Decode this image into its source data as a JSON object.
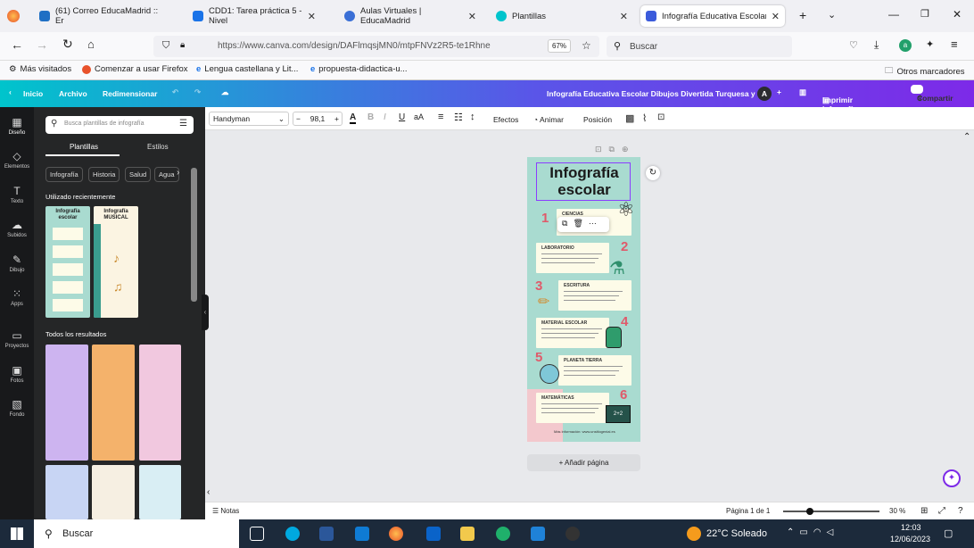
{
  "tabs": [
    {
      "label": "(61) Correo EducaMadrid :: Er"
    },
    {
      "label": "CDD1: Tarea práctica 5 - Nivel"
    },
    {
      "label": "Aulas Virtuales | EducaMadrid"
    },
    {
      "label": "Plantillas"
    },
    {
      "label": "Infografía Educativa Escolar D"
    }
  ],
  "nav": {
    "url": "https://www.canva.com/design/DAFlmqsjMN0/mtpFNVz2R5-te1Rhne",
    "zoom": "67%",
    "search_placeholder": "Buscar"
  },
  "bookmarks": {
    "items": [
      "Más visitados",
      "Comenzar a usar Firefox",
      "Lengua castellana y Lit...",
      "propuesta-didactica-u..."
    ],
    "other": "Otros marcadores"
  },
  "canva": {
    "back": "Inicio",
    "archivo": "Archivo",
    "redimensionar": "Redimensionar",
    "doc_title": "Infografía Educativa Escolar Dibujos Divertida Turquesa y C...",
    "avatar": "A",
    "print": "Imprimir infografías",
    "share": "Compartir"
  },
  "toolbar": {
    "font": "Handyman",
    "size": "98,1",
    "effects": "Efectos",
    "animate": "Animar",
    "position": "Posición"
  },
  "rail": [
    "Diseño",
    "Elementos",
    "Texto",
    "Subidos",
    "Dibujo",
    "Apps",
    "Proyectos",
    "Fotos",
    "Fondo"
  ],
  "panel": {
    "search_placeholder": "Busca plantillas de infografía",
    "tab_plantillas": "Plantillas",
    "tab_estilos": "Estilos",
    "chips": [
      "Infografía",
      "Historia",
      "Salud",
      "Agua"
    ],
    "recent_title": "Utilizado recientemente",
    "recent": [
      {
        "title": "Infografía escolar"
      },
      {
        "title": "Infografía MUSICAL"
      }
    ],
    "all_title": "Todos los resultados"
  },
  "design": {
    "title_line1": "Infografía",
    "title_line2": "escolar",
    "sections": [
      {
        "num": "1",
        "label": "CIENCIAS"
      },
      {
        "num": "2",
        "label": "LABORATORIO"
      },
      {
        "num": "3",
        "label": "ESCRITURA"
      },
      {
        "num": "4",
        "label": "MATERIAL ESCOLAR"
      },
      {
        "num": "5",
        "label": "PLANETA TIERRA"
      },
      {
        "num": "6",
        "label": "MATEMÁTICAS"
      }
    ],
    "footer": "Más información: www.unsitiogenial.es"
  },
  "add_page": "+ Añadir página",
  "status": {
    "notes": "Notas",
    "page": "Página 1 de 1",
    "zoom": "30 %"
  },
  "taskbar": {
    "search": "Buscar",
    "weather": "22°C Soleado",
    "time": "12:03",
    "date": "12/06/2023"
  },
  "colors": {
    "accent": "#7d2ae8",
    "teal": "#00c4cc",
    "number": "#e05a6a"
  }
}
